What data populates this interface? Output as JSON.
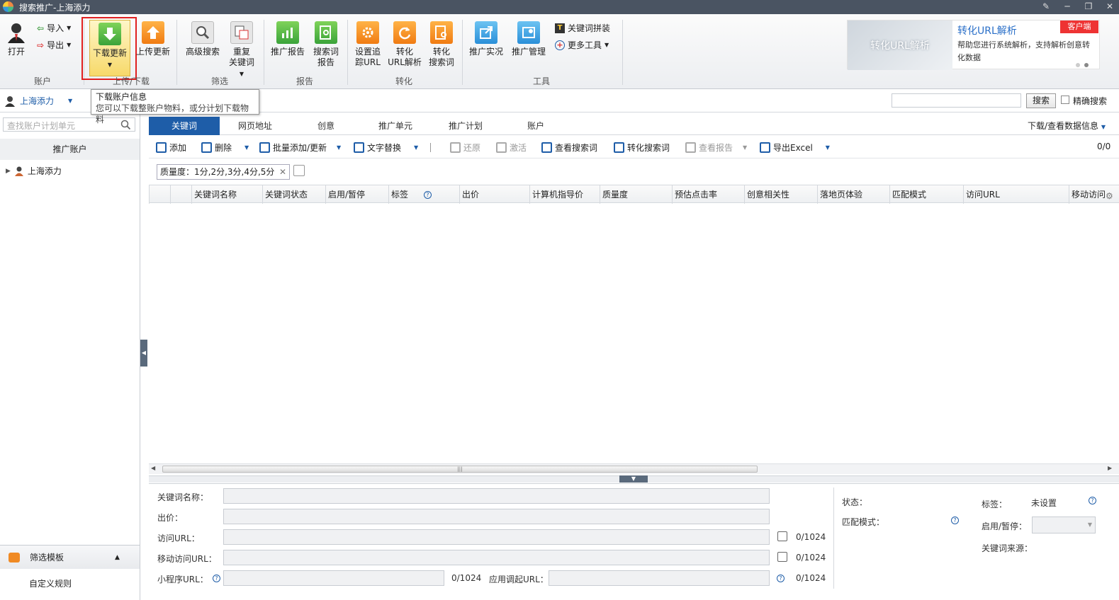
{
  "window": {
    "title": "搜索推广-上海添力"
  },
  "ribbon": {
    "open": "打开",
    "import": "导入",
    "export": "导出",
    "download_update": "下载更新",
    "upload_update": "上传更新",
    "advanced_search": "高级搜索",
    "dup_kw_line1": "重复",
    "dup_kw_line2": "关键词",
    "promo_report": "推广报告",
    "search_term_line1": "搜索词",
    "search_term_line2": "报告",
    "track_url_line1": "设置追",
    "track_url_line2": "踪URL",
    "conv_url_line1": "转化",
    "conv_url_line2": "URL解析",
    "conv_search_line1": "转化",
    "conv_search_line2": "搜索词",
    "promo_live": "推广实况",
    "promo_manage": "推广管理",
    "kw_combine": "关键词拼装",
    "more_tools": "更多工具",
    "groups": {
      "account": "账户",
      "updown": "上传/下载",
      "filter": "筛选",
      "report": "报告",
      "convert": "转化",
      "tools": "工具"
    }
  },
  "promo": {
    "image_text": "转化URL解析",
    "title": "转化URL解析",
    "tag": "客户端",
    "desc": "帮助您进行系统解析，支持解析创意转化数据"
  },
  "tooltip": {
    "title": "下载账户信息",
    "body": "您可以下载整账户物料，或分计划下载物料"
  },
  "account": {
    "name": "上海添力",
    "search_btn": "搜索",
    "exact_search": "精确搜索"
  },
  "left": {
    "search_placeholder": "查找账户计划单元",
    "header": "推广账户",
    "tree_item": "上海添力",
    "filter_template": "筛选模板",
    "custom_rule": "自定义规则"
  },
  "tabs": [
    "关键词",
    "网页地址",
    "创意",
    "推广单元",
    "推广计划",
    "账户"
  ],
  "tabs_right": "下载/查看数据信息",
  "toolbar": {
    "add": "添加",
    "delete": "删除",
    "batch": "批量添加/更新",
    "replace": "文字替换",
    "restore": "还原",
    "activate": "激活",
    "view_search": "查看搜索词",
    "conv_search": "转化搜索词",
    "view_report": "查看报告",
    "export_excel": "导出Excel",
    "counter": "0/0"
  },
  "filter_chip": "质量度：1分,2分,3分,4分,5分",
  "columns": [
    "关键词名称",
    "关键词状态",
    "启用/暂停",
    "标签",
    "出价",
    "计算机指导价",
    "质量度",
    "预估点击率",
    "创意相关性",
    "落地页体验",
    "匹配模式",
    "访问URL",
    "移动访问"
  ],
  "detail": {
    "kw_name": "关键词名称：",
    "bid": "出价：",
    "url": "访问URL：",
    "mobile_url": "移动访问URL：",
    "mini_url": "小程序URL：",
    "app_url": "应用调起URL：",
    "counter": "0/1024",
    "status": "状态：",
    "match": "匹配模式：",
    "label": "标签：",
    "label_val": "未设置",
    "enable": "启用/暂停：",
    "source": "关键词来源："
  }
}
